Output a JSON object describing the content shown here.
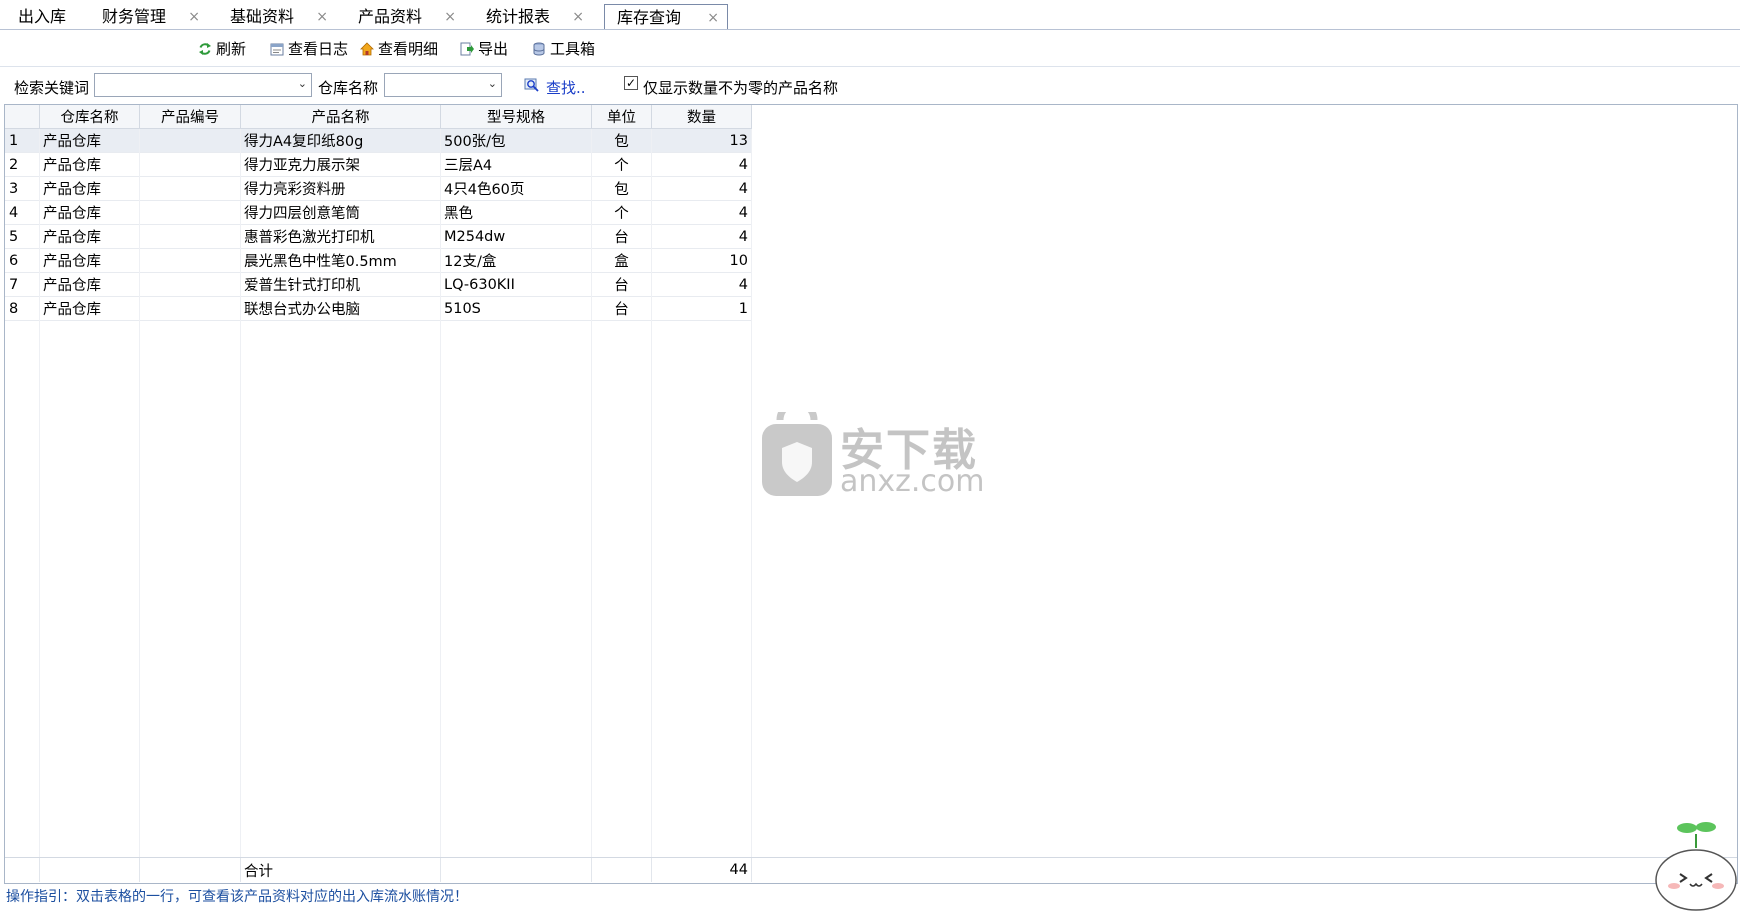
{
  "tabs": [
    {
      "label": "出入库",
      "closable": false,
      "active": false
    },
    {
      "label": "财务管理",
      "closable": true,
      "active": false
    },
    {
      "label": "基础资料",
      "closable": true,
      "active": false
    },
    {
      "label": "产品资料",
      "closable": true,
      "active": false
    },
    {
      "label": "统计报表",
      "closable": true,
      "active": false
    },
    {
      "label": "库存查询",
      "closable": true,
      "active": true
    }
  ],
  "close_glyph": "×",
  "toolbar": {
    "refresh": "刷新",
    "view_log": "查看日志",
    "view_detail": "查看明细",
    "export": "导出",
    "toolbox": "工具箱"
  },
  "search": {
    "keyword_label": "检索关键词",
    "keyword_value": "",
    "warehouse_label": "仓库名称",
    "warehouse_value": "",
    "find_label": "查找..",
    "nonzero_label": "仅显示数量不为零的产品名称",
    "nonzero_checked": true
  },
  "grid": {
    "columns": [
      "仓库名称",
      "产品编号",
      "产品名称",
      "型号规格",
      "单位",
      "数量"
    ],
    "rows": [
      {
        "n": "1",
        "warehouse": "产品仓库",
        "code": "",
        "name": "得力A4复印纸80g",
        "spec": "500张/包",
        "unit": "包",
        "qty": "13"
      },
      {
        "n": "2",
        "warehouse": "产品仓库",
        "code": "",
        "name": "得力亚克力展示架",
        "spec": "三层A4",
        "unit": "个",
        "qty": "4"
      },
      {
        "n": "3",
        "warehouse": "产品仓库",
        "code": "",
        "name": "得力亮彩资料册",
        "spec": "4只4色60页",
        "unit": "包",
        "qty": "4"
      },
      {
        "n": "4",
        "warehouse": "产品仓库",
        "code": "",
        "name": "得力四层创意笔筒",
        "spec": "黑色",
        "unit": "个",
        "qty": "4"
      },
      {
        "n": "5",
        "warehouse": "产品仓库",
        "code": "",
        "name": "惠普彩色激光打印机",
        "spec": "M254dw",
        "unit": "台",
        "qty": "4"
      },
      {
        "n": "6",
        "warehouse": "产品仓库",
        "code": "",
        "name": "晨光黑色中性笔0.5mm",
        "spec": "12支/盒",
        "unit": "盒",
        "qty": "10"
      },
      {
        "n": "7",
        "warehouse": "产品仓库",
        "code": "",
        "name": "爱普生针式打印机",
        "spec": "LQ-630KII",
        "unit": "台",
        "qty": "4"
      },
      {
        "n": "8",
        "warehouse": "产品仓库",
        "code": "",
        "name": "联想台式办公电脑",
        "spec": "510S",
        "unit": "台",
        "qty": "1"
      }
    ],
    "footer_label": "合计",
    "footer_total": "44"
  },
  "watermark": {
    "cn": "安下载",
    "url": "anxz.com"
  },
  "status": "操作指引：双击表格的一行，可查看该产品资料对应的出入库流水账情况！",
  "colors": {
    "accent": "#1a3ec8",
    "status": "#1c4fa0",
    "grid_border": "#a9b6c8",
    "header_bg": "#f4f6f9"
  }
}
